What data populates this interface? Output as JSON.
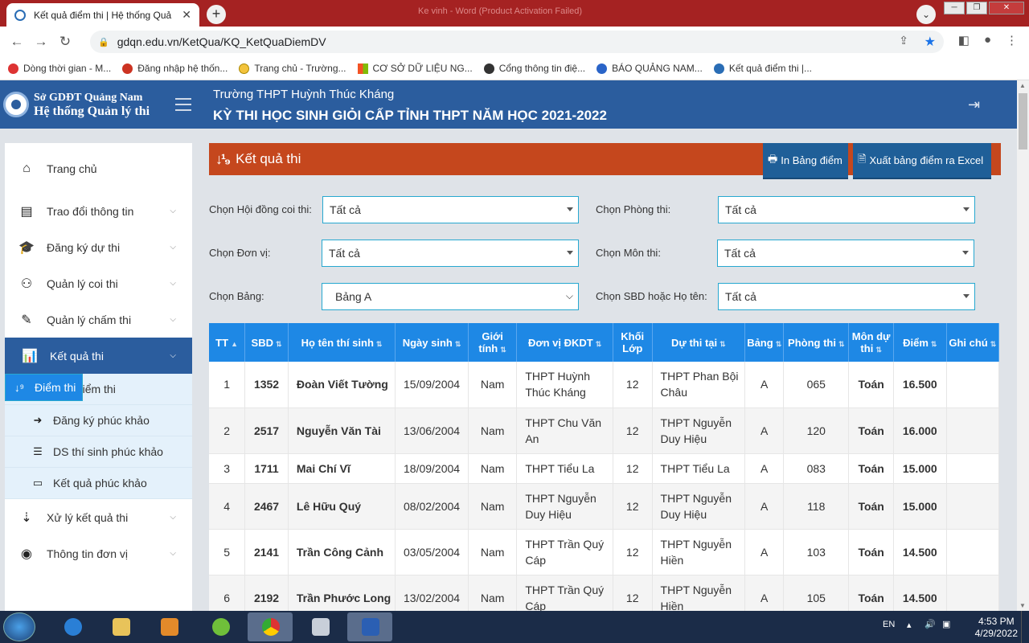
{
  "browser": {
    "tab_title": "Kết quả điểm thi | Hệ thống Quả",
    "url": "gdqn.edu.vn/KetQua/KQ_KetQuaDiemDV",
    "window_caption": "Ke vinh - Word (Product Activation Failed)",
    "bookmarks": [
      "Dòng thời gian - M...",
      "Đăng nhập hệ thốn...",
      "Trang chủ - Trường...",
      "CƠ SỞ DỮ LIỆU NG...",
      "Cổng thông tin điệ...",
      "BÁO QUẢNG NAM...",
      "Kết quả điểm thi |..."
    ]
  },
  "header": {
    "brand_line1": "Sở GDĐT Quảng Nam",
    "brand_line2": "Hệ thống Quản lý thi",
    "school": "Trường THPT Huỳnh Thúc Kháng",
    "exam_title": "KỲ THI HỌC SINH GIỎI CẤP TỈNH THPT NĂM HỌC 2021-2022"
  },
  "sidebar": {
    "home": "Trang chủ",
    "items": [
      "Trao đổi thông tin",
      "Đăng ký dự thi",
      "Quản lý coi thi",
      "Quản lý chấm thi",
      "Kết quả thi"
    ],
    "subitems": [
      "Điểm thi",
      "Phổ điểm thi",
      "Đăng ký phúc khảo",
      "DS thí sinh phúc khảo",
      "Kết quả phúc khảo"
    ],
    "after": [
      "Xử lý kết quả thi",
      "Thông tin đơn vị"
    ]
  },
  "page": {
    "title": "Kết quả thi",
    "print_button": "In Bảng điểm",
    "excel_button": "Xuất bảng điểm ra Excel"
  },
  "filters": {
    "hoi_dong_label": "Chọn Hội đồng coi thi:",
    "hoi_dong_value": "Tất cả",
    "phong_label": "Chọn Phòng thi:",
    "phong_value": "Tất cả",
    "don_vi_label": "Chọn Đơn vị:",
    "don_vi_value": "Tất cả",
    "mon_label": "Chọn Môn thi:",
    "mon_value": "Tất cả",
    "bang_label": "Chọn Bảng:",
    "bang_value": "Bảng A",
    "sbd_label": "Chọn SBD hoặc Họ tên:",
    "sbd_value": "Tất cả"
  },
  "table": {
    "headers": [
      "TT",
      "SBD",
      "Họ tên thí sinh",
      "Ngày sinh",
      "Giới tính",
      "Đơn vị ĐKDT",
      "Khối Lớp",
      "Dự thi tại",
      "Bảng",
      "Phòng thi",
      "Môn dự thi",
      "Điểm",
      "Ghi chú"
    ],
    "rows": [
      [
        "1",
        "1352",
        "Đoàn Viết Tường",
        "15/09/2004",
        "Nam",
        "THPT Huỳnh Thúc Kháng",
        "12",
        "THPT Phan Bội Châu",
        "A",
        "065",
        "Toán",
        "16.500",
        ""
      ],
      [
        "2",
        "2517",
        "Nguyễn Văn Tài",
        "13/06/2004",
        "Nam",
        "THPT Chu Văn An",
        "12",
        "THPT Nguyễn Duy Hiệu",
        "A",
        "120",
        "Toán",
        "16.000",
        ""
      ],
      [
        "3",
        "1711",
        "Mai Chí Vĩ",
        "18/09/2004",
        "Nam",
        "THPT Tiểu La",
        "12",
        "THPT Tiểu La",
        "A",
        "083",
        "Toán",
        "15.000",
        ""
      ],
      [
        "4",
        "2467",
        "Lê Hữu Quý",
        "08/02/2004",
        "Nam",
        "THPT Nguyễn Duy Hiệu",
        "12",
        "THPT Nguyễn Duy Hiệu",
        "A",
        "118",
        "Toán",
        "15.000",
        ""
      ],
      [
        "5",
        "2141",
        "Trần Công Cảnh",
        "03/05/2004",
        "Nam",
        "THPT Trần Quý Cáp",
        "12",
        "THPT Nguyễn Hiền",
        "A",
        "103",
        "Toán",
        "14.500",
        ""
      ],
      [
        "6",
        "2192",
        "Trần Phước Long",
        "13/02/2004",
        "Nam",
        "THPT Trần Quý Cáp",
        "12",
        "THPT Nguyễn Hiền",
        "A",
        "105",
        "Toán",
        "14.500",
        ""
      ]
    ]
  },
  "taskbar": {
    "lang": "EN",
    "time": "4:53 PM",
    "date": "4/29/2022"
  }
}
